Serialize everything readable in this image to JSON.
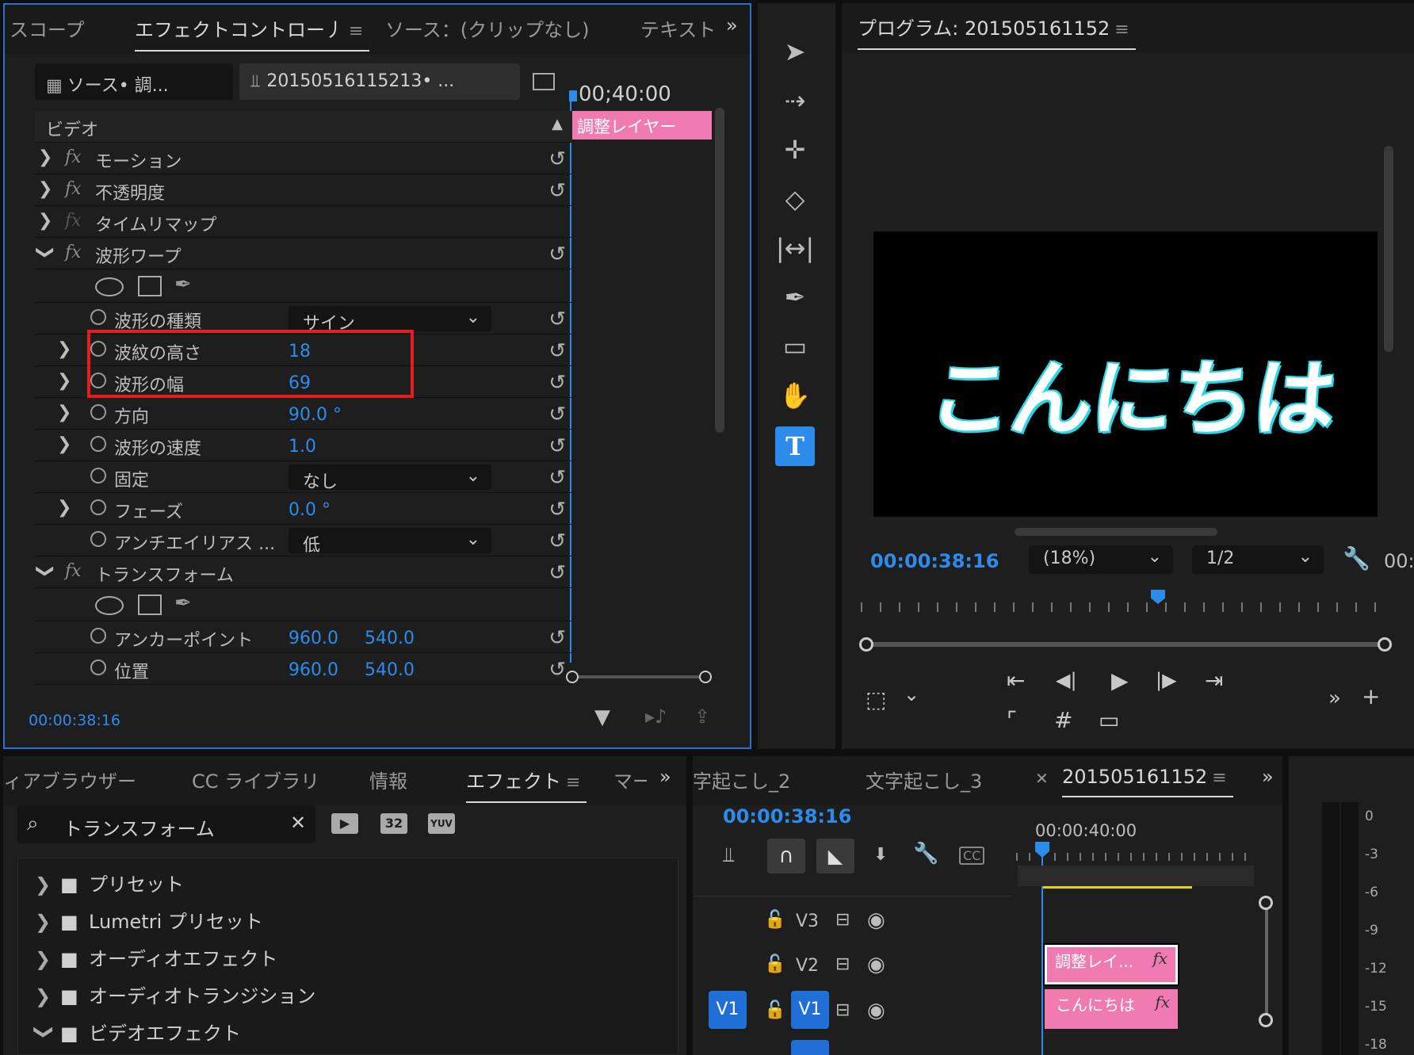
{
  "effect_controls": {
    "tabs": [
      "スコープ",
      "エフェクトコントロー丿",
      "ソース：(クリップなし)",
      "テキスト"
    ],
    "menu_icon": "≡",
    "more_icon": "»",
    "source_dropdown": "ソース• 調...",
    "sequence_dropdown": "20150516115213• ...",
    "timecode_ruler": "00;40:00",
    "clip_bar": "調整レイヤー",
    "video_header": "ビデオ",
    "rows": [
      {
        "name": "モーション"
      },
      {
        "name": "不透明度"
      },
      {
        "name": "タイムリマップ"
      },
      {
        "name": "波形ワープ"
      }
    ],
    "wave": {
      "type_label": "波形の種類",
      "type_value": "サイン",
      "height_label": "波紋の高さ",
      "height_value": "18",
      "width_label": "波形の幅",
      "width_value": "69",
      "direction_label": "方向",
      "direction_value": "90.0 °",
      "speed_label": "波形の速度",
      "speed_value": "1.0",
      "pin_label": "固定",
      "pin_value": "なし",
      "phase_label": "フェーズ",
      "phase_value": "0.0 °",
      "aa_label": "アンチエイリアス ...",
      "aa_value": "低"
    },
    "transform": {
      "name": "トランスフォーム",
      "anchor_label": "アンカーポイント",
      "anchor_x": "960.0",
      "anchor_y": "540.0",
      "position_label": "位置",
      "position_x": "960.0",
      "position_y": "540.0"
    },
    "footer_timecode": "00:00:38:16",
    "highlight_color": "#e41e1e"
  },
  "program": {
    "title": "プログラム: 201505161152",
    "preview_text": "こんにちは",
    "timecode": "00:00:38:16",
    "zoom": "(18%)",
    "resolution": "1/2",
    "right_timecode": "00:"
  },
  "effects_panel": {
    "tabs": [
      "ィアブラウザー",
      "CC ライブラリ",
      "情報",
      "エフェクト",
      "マー"
    ],
    "search_value": "トランスフォーム",
    "badges": [
      "32",
      "YUV"
    ],
    "folders": [
      "プリセット",
      "Lumetri プリセット",
      "オーディオエフェクト",
      "オーディオトランジション",
      "ビデオエフェクト"
    ]
  },
  "timeline": {
    "tabs": [
      "字起こし_2",
      "文字起こし_3",
      "201505161152"
    ],
    "timecode": "00:00:38:16",
    "ruler_time": "00:00:40:00",
    "tracks": [
      "V3",
      "V2",
      "V1"
    ],
    "src_patch": "V1",
    "clip_v2": "調整レイ...",
    "clip_v1": "こんにちは",
    "fx": "fx"
  },
  "meter": [
    "0",
    "-3",
    "-6",
    "-9",
    "-12",
    "-15",
    "-18"
  ],
  "colors": {
    "accent": "#2d8ceb",
    "clip_pink": "#f07bb1",
    "bg": "#1e1e1e"
  }
}
